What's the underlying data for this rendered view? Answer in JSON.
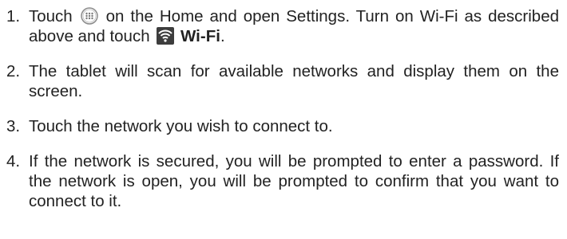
{
  "steps": [
    {
      "number": "1.",
      "part1": "Touch",
      "part2": "on the Home and open Settings. Turn on Wi-Fi as described above and touch",
      "bold": "Wi-Fi",
      "part3": ".",
      "icon_apps": "app-drawer-icon",
      "icon_wifi": "wifi-icon"
    },
    {
      "number": "2.",
      "text": "The tablet will scan for available networks and display them on the screen."
    },
    {
      "number": "3.",
      "text": "Touch the network you wish to connect to."
    },
    {
      "number": "4.",
      "text": "If the network is secured, you will be prompted to enter a password. If the network is open, you will be prompted to confirm that you want to connect to it."
    }
  ],
  "colors": {
    "text": "#222222",
    "icon_gray": "#8a8a8a",
    "icon_dark": "#3d3d3d"
  }
}
